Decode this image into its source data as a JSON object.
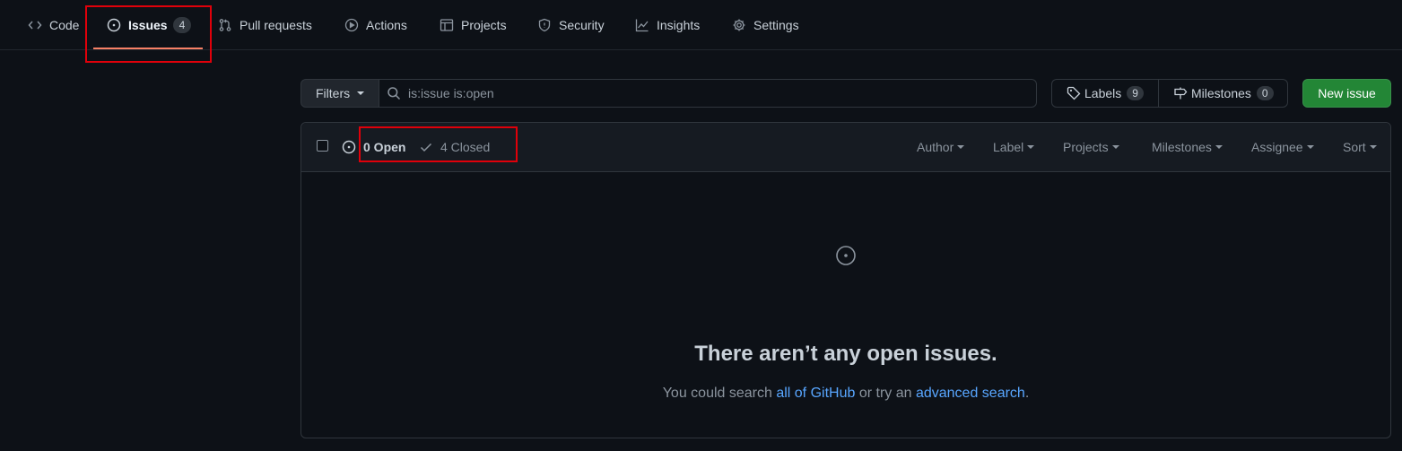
{
  "nav": {
    "tabs": [
      {
        "label": "Code",
        "icon": "code-icon"
      },
      {
        "label": "Issues",
        "icon": "issue-opened-icon",
        "counter": "4",
        "selected": true
      },
      {
        "label": "Pull requests",
        "icon": "git-pull-request-icon"
      },
      {
        "label": "Actions",
        "icon": "play-icon"
      },
      {
        "label": "Projects",
        "icon": "table-icon"
      },
      {
        "label": "Security",
        "icon": "shield-icon"
      },
      {
        "label": "Insights",
        "icon": "graph-icon"
      },
      {
        "label": "Settings",
        "icon": "gear-icon"
      }
    ]
  },
  "subnav": {
    "filters_label": "Filters",
    "search_value": "is:issue is:open",
    "labels_label": "Labels",
    "labels_count": "9",
    "milestones_label": "Milestones",
    "milestones_count": "0",
    "new_issue_label": "New issue"
  },
  "list": {
    "open_label": "0 Open",
    "closed_label": "4 Closed",
    "selects": [
      "Author",
      "Label",
      "Projects",
      "Milestones",
      "Assignee",
      "Sort"
    ]
  },
  "blankslate": {
    "title": "There aren’t any open issues.",
    "desc_prefix": "You could search ",
    "link1": "all of GitHub",
    "desc_middle": " or try an ",
    "link2": "advanced search",
    "desc_suffix": "."
  },
  "colors": {
    "background": "#0d1117",
    "accent_underline": "#f78166",
    "primary_button": "#238636",
    "link": "#58a6ff",
    "highlight_box": "#e0000a"
  }
}
